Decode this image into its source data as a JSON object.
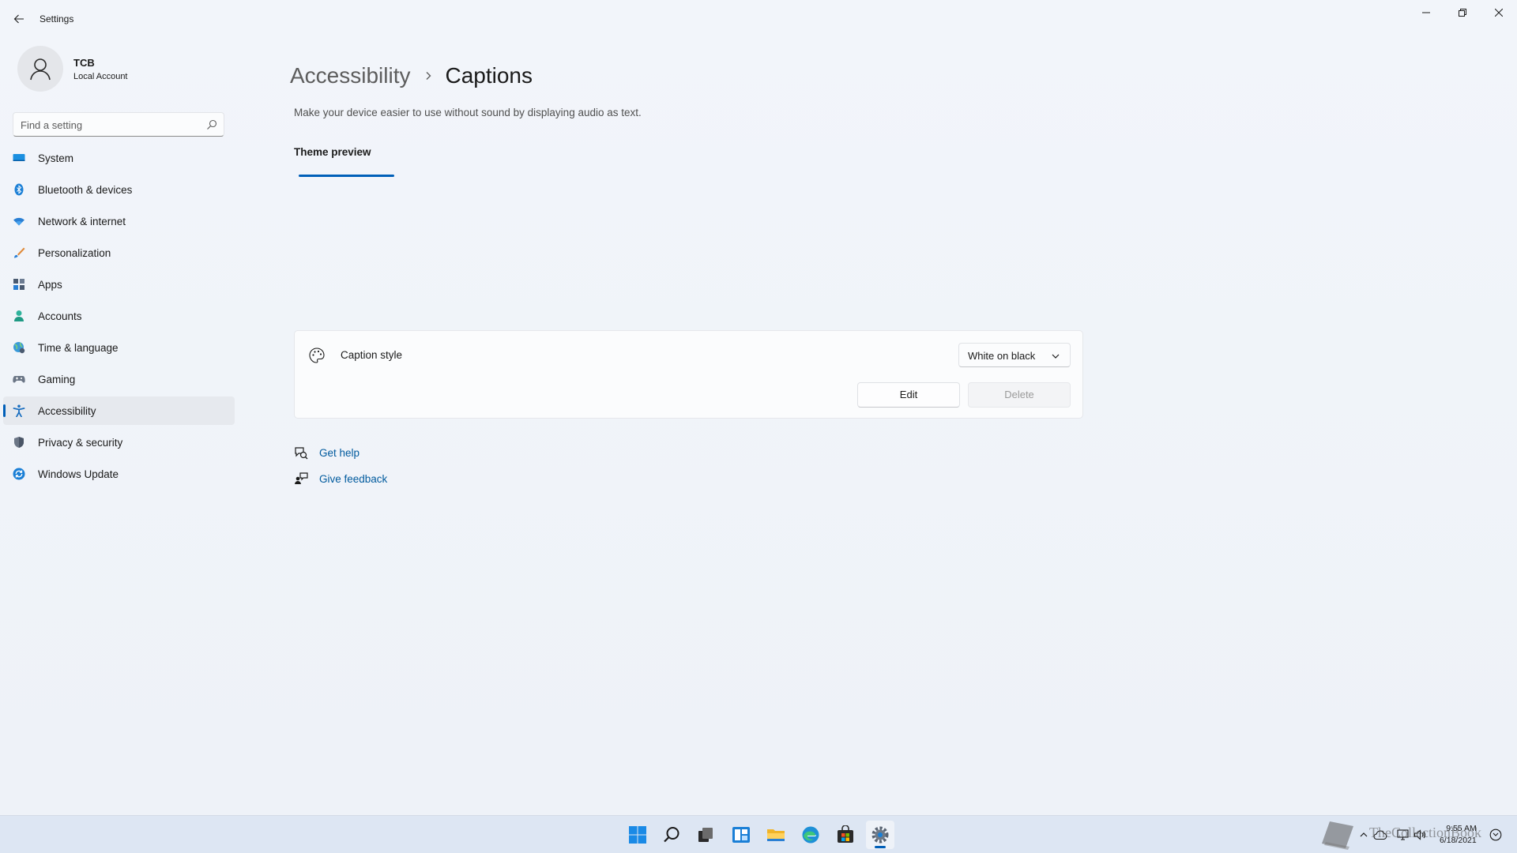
{
  "window": {
    "title": "Settings"
  },
  "account": {
    "name": "TCB",
    "type": "Local Account"
  },
  "search": {
    "placeholder": "Find a setting"
  },
  "nav": {
    "items": [
      {
        "label": "System",
        "icon": "monitor-icon"
      },
      {
        "label": "Bluetooth & devices",
        "icon": "bluetooth-icon"
      },
      {
        "label": "Network & internet",
        "icon": "wifi-icon"
      },
      {
        "label": "Personalization",
        "icon": "brush-icon"
      },
      {
        "label": "Apps",
        "icon": "apps-icon"
      },
      {
        "label": "Accounts",
        "icon": "person-icon"
      },
      {
        "label": "Time & language",
        "icon": "globe-clock-icon"
      },
      {
        "label": "Gaming",
        "icon": "gamepad-icon"
      },
      {
        "label": "Accessibility",
        "icon": "accessibility-icon",
        "active": true
      },
      {
        "label": "Privacy & security",
        "icon": "shield-icon"
      },
      {
        "label": "Windows Update",
        "icon": "update-icon"
      }
    ]
  },
  "main": {
    "breadcrumb": {
      "parent": "Accessibility",
      "current": "Captions"
    },
    "description": "Make your device easier to use without sound by displaying audio as text.",
    "tab": "Theme preview",
    "caption_style": {
      "label": "Caption style",
      "selected": "White on black",
      "edit_label": "Edit",
      "delete_label": "Delete"
    },
    "links": {
      "help": "Get help",
      "feedback": "Give feedback"
    }
  },
  "taskbar": {
    "apps": [
      "start-icon",
      "search-icon",
      "task-view-icon",
      "widgets-icon",
      "file-explorer-icon",
      "edge-icon",
      "store-icon",
      "settings-icon"
    ],
    "time": "9:55 AM",
    "date": "6/18/2021"
  },
  "watermark": {
    "text": "TheCollectionBook"
  },
  "colors": {
    "accent": "#005fb8",
    "link": "#005a9e",
    "background": "#f1f4f9",
    "taskbar": "#dde6f3"
  }
}
